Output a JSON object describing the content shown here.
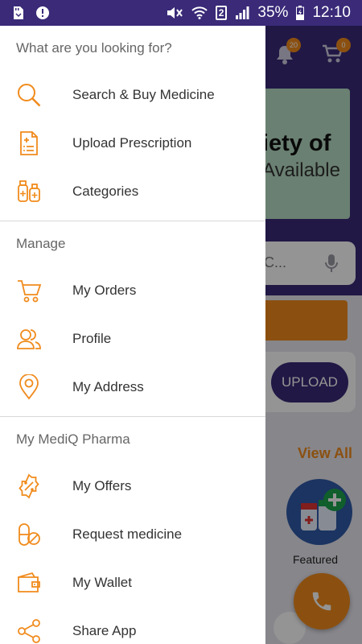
{
  "status_bar": {
    "battery_percent": "35%",
    "time": "12:10",
    "sim_slot": "2"
  },
  "background": {
    "notifications_count": "20",
    "cart_count": "0",
    "banner_line1": "iety of",
    "banner_line2": "Available",
    "search_placeholder": "C...",
    "upload_label": "UPLOAD",
    "view_all_label": "View All",
    "featured_label": "Featured"
  },
  "drawer": {
    "sections": [
      {
        "title": "What are you looking for?",
        "items": [
          {
            "label": "Search & Buy Medicine",
            "icon": "search-icon"
          },
          {
            "label": "Upload Prescription",
            "icon": "prescription-icon"
          },
          {
            "label": "Categories",
            "icon": "categories-icon"
          }
        ]
      },
      {
        "title": "Manage",
        "items": [
          {
            "label": "My Orders",
            "icon": "cart-icon"
          },
          {
            "label": "Profile",
            "icon": "profile-icon"
          },
          {
            "label": "My Address",
            "icon": "location-pin-icon"
          }
        ]
      },
      {
        "title": "My MediQ Pharma",
        "items": [
          {
            "label": "My Offers",
            "icon": "offer-badge-icon"
          },
          {
            "label": "Request medicine",
            "icon": "pill-icon"
          },
          {
            "label": "My Wallet",
            "icon": "wallet-icon"
          },
          {
            "label": "Share App",
            "icon": "share-icon"
          }
        ]
      }
    ]
  },
  "colors": {
    "primary": "#3a2a78",
    "accent": "#f08b1c"
  }
}
